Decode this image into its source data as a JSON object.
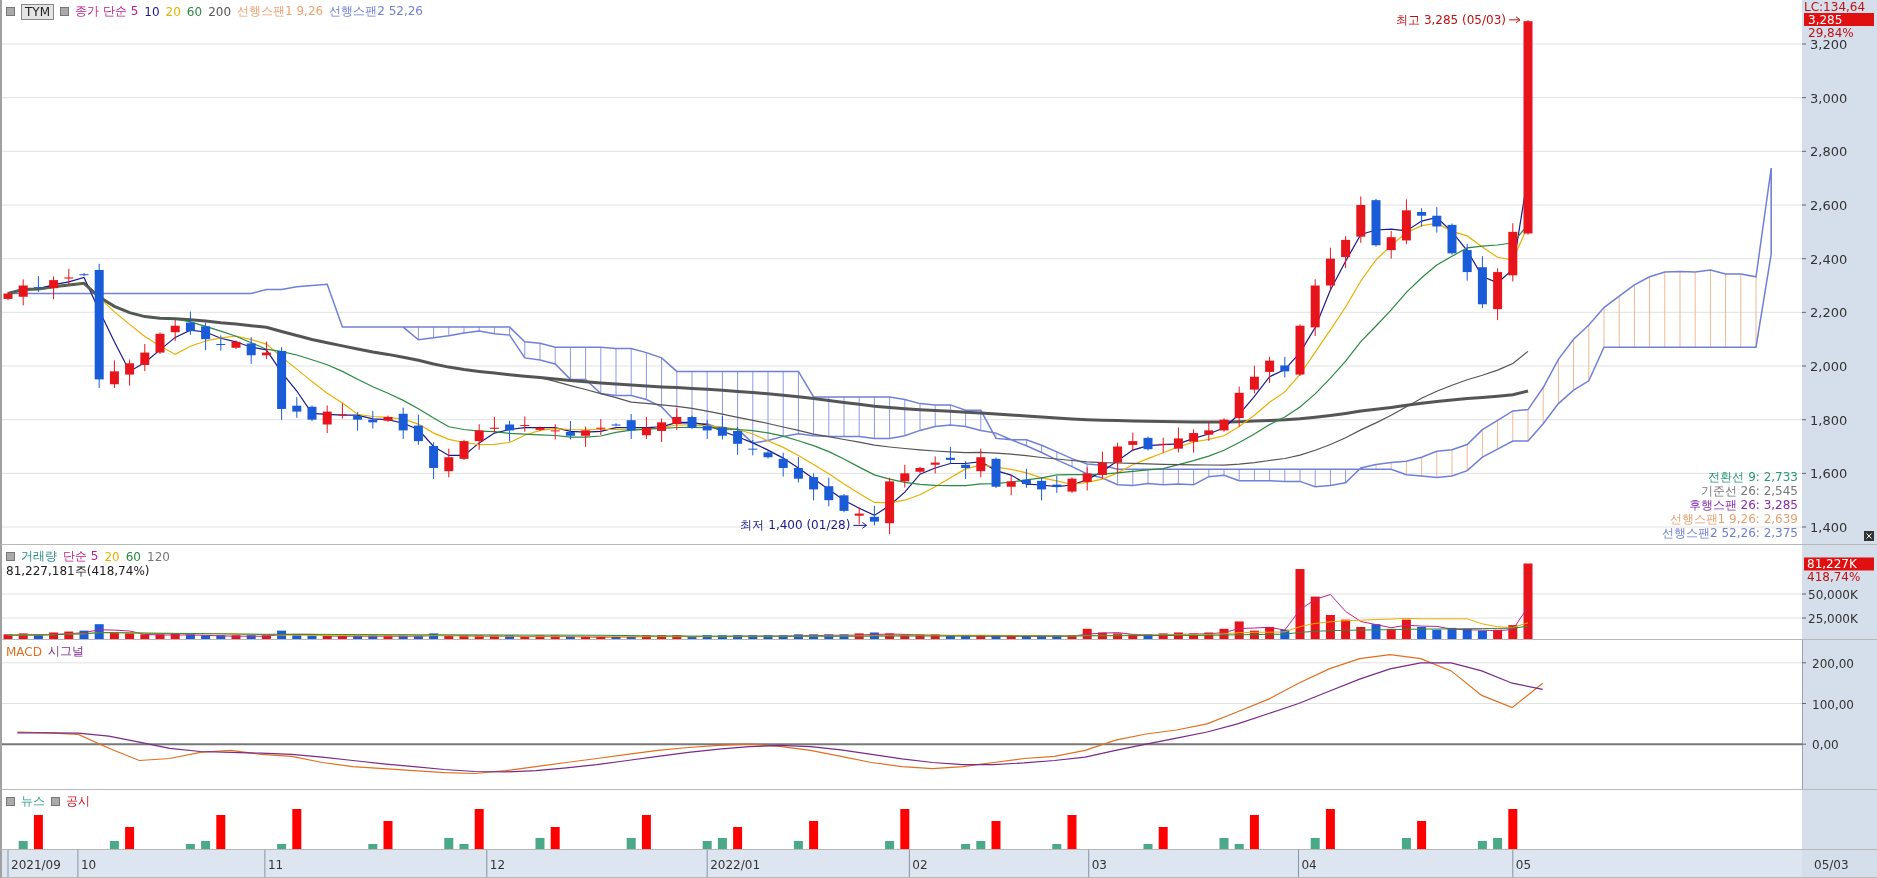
{
  "symbol": "TYM",
  "price_panel": {
    "legend": [
      {
        "text": "종가 단순 5",
        "color": "#c0208a"
      },
      {
        "text": "10",
        "color": "#1a1a8c"
      },
      {
        "text": "20",
        "color": "#e8b000"
      },
      {
        "text": "60",
        "color": "#2a8a40"
      },
      {
        "text": "200",
        "color": "#555555"
      },
      {
        "text": "선행스팬1 9,26",
        "color": "#f0a070"
      },
      {
        "text": "선행스팬2 52,26",
        "color": "#7080d8"
      }
    ],
    "axis_labels": [
      "3,200",
      "3,000",
      "2,800",
      "2,600",
      "2,400",
      "2,200",
      "2,000",
      "1,800",
      "1,600",
      "1,400"
    ],
    "high_label": "최고 3,285 (05/03)",
    "low_label": "최저 1,400 (01/28)",
    "readings": [
      {
        "text": "전환선 9: 2,733",
        "color": "#2a9a7a"
      },
      {
        "text": "기준선 26: 2,545",
        "color": "#777777"
      },
      {
        "text": "후행스팬 26: 3,285",
        "color": "#8a2ab0"
      },
      {
        "text": "선행스팬1 9,26: 2,639",
        "color": "#e8a070"
      },
      {
        "text": "선행스팬2 52,26: 2,375",
        "color": "#7080d0"
      }
    ],
    "axis": {
      "lc": "LC:134,64",
      "last_price": "3,285",
      "change": "29,84%"
    }
  },
  "volume_panel": {
    "legend": [
      {
        "text": "거래량",
        "color": "#2a8a8a"
      },
      {
        "text": "단순 5",
        "color": "#c0208a"
      },
      {
        "text": "20",
        "color": "#e8b000"
      },
      {
        "text": "60",
        "color": "#2a8a40"
      },
      {
        "text": "120",
        "color": "#777777"
      }
    ],
    "summary": "81,227,181주(418,74%)",
    "axis_labels": [
      "50,000K",
      "25,000K"
    ],
    "axis": {
      "last_volume": "81,227K",
      "ratio": "418,74%"
    }
  },
  "macd_panel": {
    "chart_data": {
      "type": "line",
      "grid": true,
      "ylim": [
        -110,
        256
      ],
      "series": [
        {
          "name": "MACD",
          "color": "#e07020",
          "values": [
            30,
            28,
            24,
            -10,
            -40,
            -35,
            -20,
            -15,
            -25,
            -30,
            -45,
            -55,
            -60,
            -65,
            -70,
            -72,
            -65,
            -55,
            -45,
            -35,
            -25,
            -15,
            -8,
            -3,
            0,
            -5,
            -15,
            -30,
            -45,
            -55,
            -60,
            -55,
            -45,
            -35,
            -30,
            -15,
            10,
            25,
            35,
            50,
            80,
            110,
            150,
            185,
            210,
            220,
            210,
            180,
            120,
            90,
            150,
            null,
            null,
            null,
            null,
            null,
            null,
            null,
            null
          ]
        },
        {
          "name": "시그널",
          "color": "#7a2a8a",
          "values": [
            28,
            28,
            27,
            20,
            5,
            -10,
            -18,
            -20,
            -22,
            -25,
            -32,
            -40,
            -48,
            -55,
            -62,
            -67,
            -68,
            -65,
            -58,
            -50,
            -40,
            -30,
            -20,
            -12,
            -6,
            -3,
            -6,
            -14,
            -25,
            -36,
            -45,
            -50,
            -50,
            -46,
            -40,
            -32,
            -15,
            0,
            15,
            30,
            50,
            75,
            100,
            130,
            160,
            185,
            200,
            200,
            180,
            150,
            135,
            null,
            null,
            null,
            null,
            null,
            null,
            null,
            null
          ]
        }
      ],
      "yticks": [
        {
          "value": 0,
          "label": "0,00"
        },
        {
          "value": 100,
          "label": "100,00"
        },
        {
          "value": 200,
          "label": "200,00"
        }
      ]
    }
  },
  "news_panel": {
    "legend": [
      {
        "text": "뉴스",
        "kind": "news"
      },
      {
        "text": "공시",
        "kind": "disclosure"
      }
    ]
  },
  "date_labels": [
    "2021/09",
    "10",
    "11",
    "12",
    "2022/01",
    "02",
    "03",
    "04",
    "05"
  ],
  "axis_date": "05/03"
}
